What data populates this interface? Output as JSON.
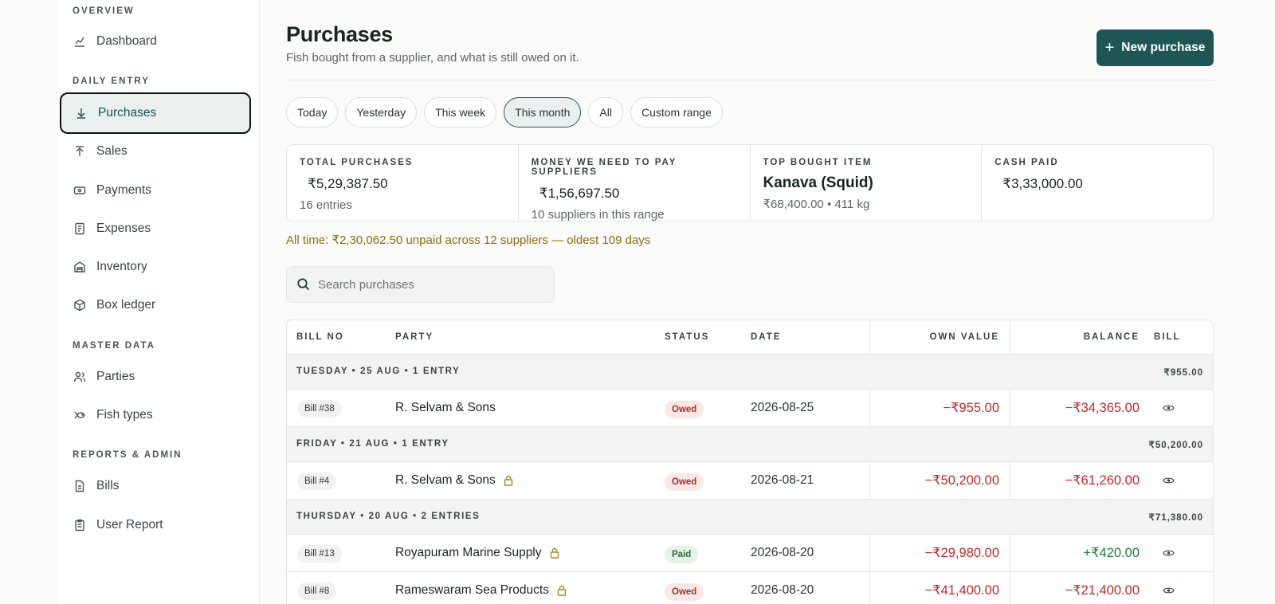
{
  "sidebar": {
    "sections": [
      {
        "label": "OVERVIEW"
      },
      {
        "label": "DAILY ENTRY"
      },
      {
        "label": "MASTER DATA"
      },
      {
        "label": "REPORTS & ADMIN"
      }
    ],
    "items": [
      {
        "label": "Dashboard",
        "icon": "chart-icon"
      },
      {
        "label": "Purchases",
        "icon": "arrow-down-icon",
        "active": true
      },
      {
        "label": "Sales",
        "icon": "arrow-up-icon"
      },
      {
        "label": "Payments",
        "icon": "banknote-icon"
      },
      {
        "label": "Expenses",
        "icon": "receipt-icon"
      },
      {
        "label": "Inventory",
        "icon": "warehouse-icon"
      },
      {
        "label": "Box ledger",
        "icon": "box-icon"
      },
      {
        "label": "Parties",
        "icon": "users-icon"
      },
      {
        "label": "Fish types",
        "icon": "fish-icon"
      },
      {
        "label": "Bills",
        "icon": "file-icon"
      },
      {
        "label": "User Report",
        "icon": "clipboard-icon"
      }
    ]
  },
  "header": {
    "title": "Purchases",
    "subtitle": "Fish bought from a supplier, and what is still owed on it.",
    "new_button": "New purchase"
  },
  "filters": [
    "Today",
    "Yesterday",
    "This week",
    "This month",
    "All",
    "Custom range"
  ],
  "selected_filter": "This month",
  "stats": [
    {
      "label": "TOTAL PURCHASES",
      "value": "₹5,29,387.50",
      "sub": "16 entries"
    },
    {
      "label": "MONEY WE NEED TO PAY SUPPLIERS",
      "value": "₹1,56,697.50",
      "sub": "10 suppliers in this range"
    },
    {
      "label": "TOP BOUGHT ITEM",
      "value": "Kanava (Squid)",
      "sub": "₹68,400.00 • 411 kg"
    },
    {
      "label": "CASH PAID",
      "value": "₹3,33,000.00",
      "sub": ""
    }
  ],
  "alltime_note": "All time: ₹2,30,062.50 unpaid across 12 suppliers — oldest 109 days",
  "search": {
    "placeholder": "Search purchases"
  },
  "table": {
    "columns": [
      "BILL NO",
      "PARTY",
      "STATUS",
      "DATE",
      "OWN VALUE",
      "BALANCE",
      "BILL"
    ],
    "groups": [
      {
        "label": "TUESDAY • 25 AUG • 1 ENTRY",
        "total": "₹955.00"
      },
      {
        "label": "FRIDAY • 21 AUG • 1 ENTRY",
        "total": "₹50,200.00"
      },
      {
        "label": "THURSDAY • 20 AUG • 2 ENTRIES",
        "total": "₹71,380.00"
      }
    ],
    "rows": [
      {
        "bill": "Bill #38",
        "party": "R. Selvam & Sons",
        "status": "Owed",
        "date": "2026-08-25",
        "own": "−₹955.00",
        "balance": "−₹34,365.00"
      },
      {
        "bill": "Bill #4",
        "party": "R. Selvam & Sons",
        "status": "Owed",
        "date": "2026-08-21",
        "own": "−₹50,200.00",
        "balance": "−₹61,260.00"
      },
      {
        "bill": "Bill #13",
        "party": "Royapuram Marine Supply",
        "status": "Paid",
        "date": "2026-08-20",
        "own": "−₹29,980.00",
        "balance": "+₹420.00"
      },
      {
        "bill": "Bill #8",
        "party": "Rameswaram Sea Products",
        "status": "Owed",
        "date": "2026-08-20",
        "own": "−₹41,400.00",
        "balance": "−₹21,400.00"
      }
    ]
  },
  "colors": {
    "accent": "#1e5657",
    "owed": "#c02828",
    "paid": "#1f7a3a",
    "warning": "#8a6a10"
  }
}
